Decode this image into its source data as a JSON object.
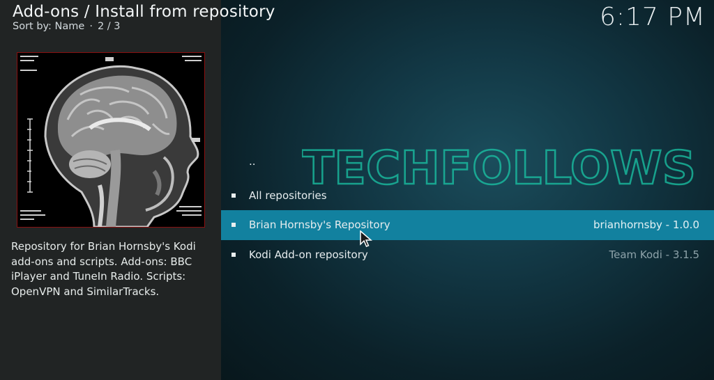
{
  "header": {
    "title": "Add-ons / Install from repository",
    "sort_label": "Sort by: Name",
    "page_indicator": "2 / 3"
  },
  "clock": "6:17 PM",
  "thumbnail": {
    "alt": "Brain MRI scan"
  },
  "description": "Repository for Brian Hornsby's Kodi add-ons and scripts. Add-ons: BBC iPlayer and TuneIn Radio. Scripts: OpenVPN and SimilarTracks.",
  "watermark": "TECHFOLLOWS",
  "list": [
    {
      "label": "..",
      "version": "",
      "selected": false
    },
    {
      "label": "All repositories",
      "version": "",
      "selected": false
    },
    {
      "label": "Brian Hornsby's Repository",
      "version": "brianhornsby - 1.0.0",
      "selected": true
    },
    {
      "label": "Kodi Add-on repository",
      "version": "Team Kodi - 3.1.5",
      "selected": false
    }
  ],
  "colors": {
    "selected_row": "#12819f",
    "left_panel": "#212424",
    "thumb_border": "#8b1010"
  }
}
